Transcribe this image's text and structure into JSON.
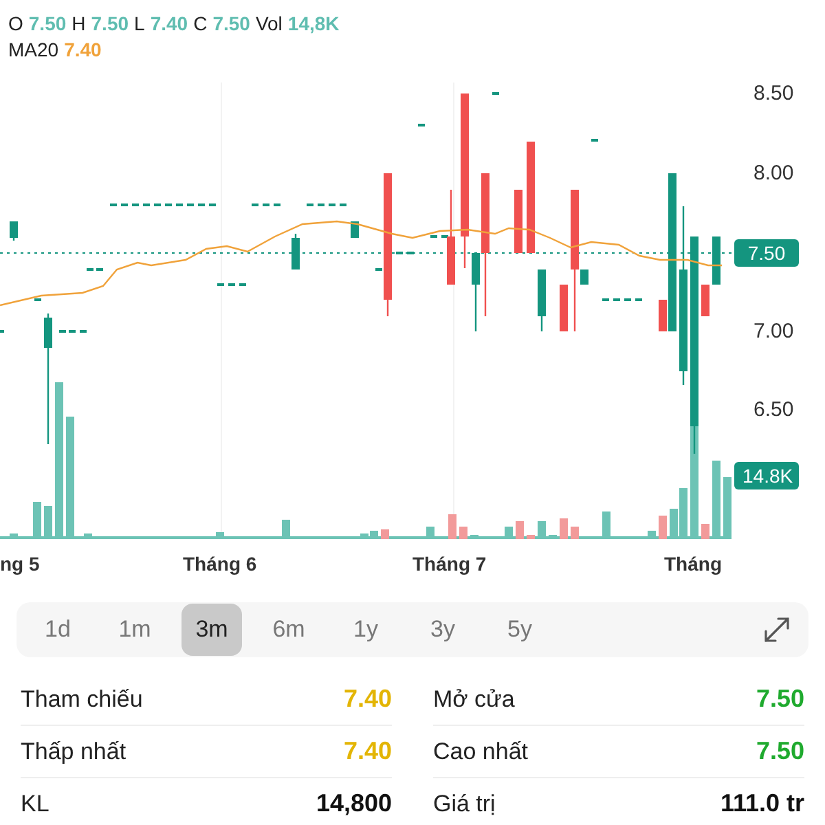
{
  "ohlc": [
    {
      "label": "O",
      "value": "7.50"
    },
    {
      "label": "H",
      "value": "7.50"
    },
    {
      "label": "L",
      "value": "7.40"
    },
    {
      "label": "C",
      "value": "7.50"
    },
    {
      "label": "Vol",
      "value": "14,8K"
    }
  ],
  "ma": {
    "label": "MA20",
    "value": "7.40"
  },
  "chart": {
    "price_labels": [
      "8.50",
      "8.00",
      "7.00",
      "6.50"
    ],
    "last_price": "7.50",
    "last_volume": "14.8K",
    "months": [
      "ng 5",
      "Tháng 6",
      "Tháng 7",
      "Tháng"
    ]
  },
  "ranges": [
    {
      "label": "1d",
      "selected": false
    },
    {
      "label": "1m",
      "selected": false
    },
    {
      "label": "3m",
      "selected": true
    },
    {
      "label": "6m",
      "selected": false
    },
    {
      "label": "1y",
      "selected": false
    },
    {
      "label": "3y",
      "selected": false
    },
    {
      "label": "5y",
      "selected": false
    }
  ],
  "stats": [
    [
      {
        "label": "Tham chiếu",
        "value": "7.40",
        "color": "#e3b505"
      },
      {
        "label": "Thấp nhất",
        "value": "7.40",
        "color": "#e3b505"
      },
      {
        "label": "KL",
        "value": "14,800",
        "color": "#111111"
      }
    ],
    [
      {
        "label": "Mở cửa",
        "value": "7.50",
        "color": "#1faa2e"
      },
      {
        "label": "Cao nhất",
        "value": "7.50",
        "color": "#1faa2e"
      },
      {
        "label": "Giá trị",
        "value": "111.0 tr",
        "color": "#111111"
      }
    ]
  ]
}
